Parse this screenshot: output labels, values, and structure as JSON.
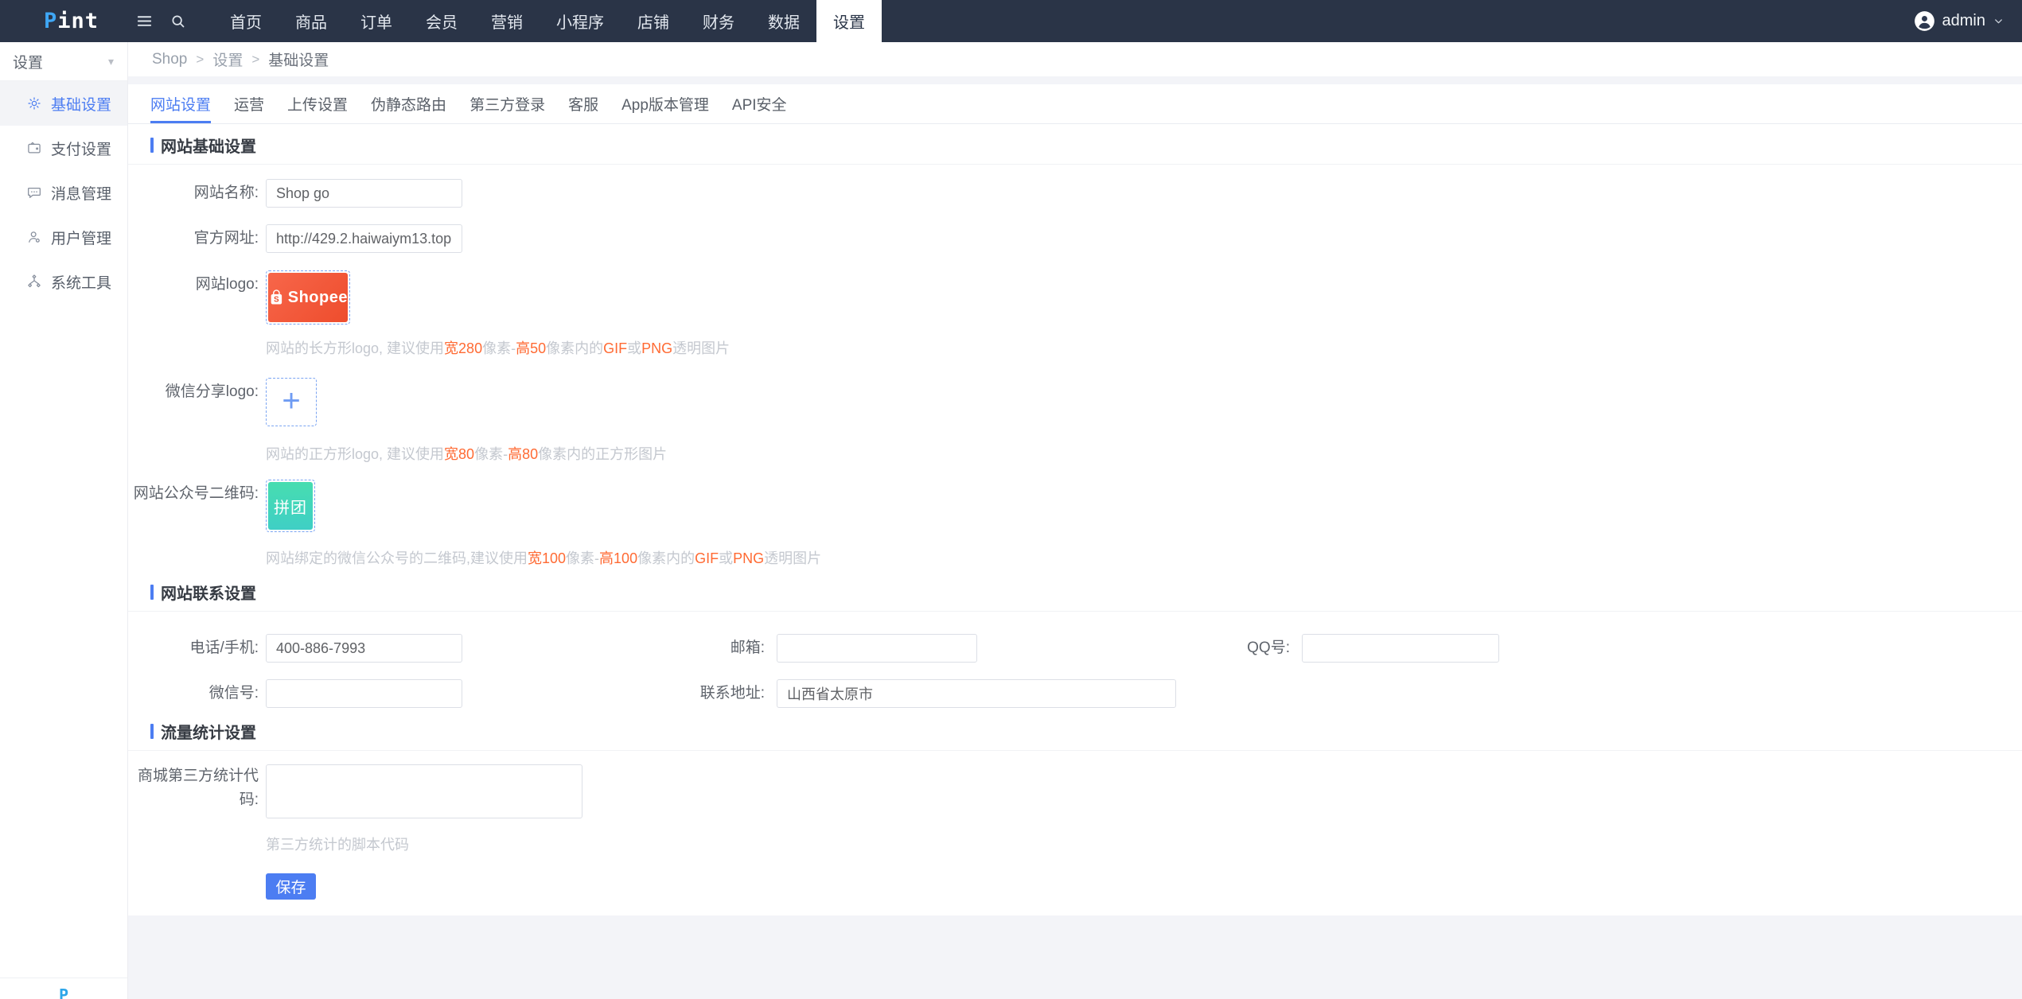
{
  "theme": {
    "navbar-bg": "#2a3447",
    "accent": "#4c7df2",
    "highlight": "#ff6a33",
    "shopee-a": "#f7664a",
    "shopee-b": "#ee4d2d",
    "qr-a": "#47ddb0",
    "qr-b": "#3fcfc5",
    "logo-blue": "#3fa7f5"
  },
  "navbar": {
    "logo_first": "P",
    "logo_rest": "int",
    "items": [
      {
        "label": "首页"
      },
      {
        "label": "商品"
      },
      {
        "label": "订单"
      },
      {
        "label": "会员"
      },
      {
        "label": "营销"
      },
      {
        "label": "小程序"
      },
      {
        "label": "店铺"
      },
      {
        "label": "财务"
      },
      {
        "label": "数据"
      },
      {
        "label": "设置"
      }
    ],
    "active_item": "设置",
    "user": {
      "name": "admin"
    }
  },
  "sidebar": {
    "title": "设置",
    "items": [
      {
        "label": "基础设置"
      },
      {
        "label": "支付设置"
      },
      {
        "label": "消息管理"
      },
      {
        "label": "用户管理"
      },
      {
        "label": "系统工具"
      }
    ],
    "active_item": "基础设置",
    "footer_logo": "P"
  },
  "breadcrumb": {
    "parts": [
      "Shop",
      "设置",
      "基础设置"
    ],
    "separator": ">"
  },
  "tabs": [
    {
      "label": "网站设置"
    },
    {
      "label": "运营"
    },
    {
      "label": "上传设置"
    },
    {
      "label": "伪静态路由"
    },
    {
      "label": "第三方登录"
    },
    {
      "label": "客服"
    },
    {
      "label": "App版本管理"
    },
    {
      "label": "API安全"
    }
  ],
  "active_tab": "网站设置",
  "form": {
    "basic": {
      "title": "网站基础设置",
      "site_name": {
        "label": "网站名称:",
        "value": "Shop go"
      },
      "site_url": {
        "label": "官方网址:",
        "value": "http://429.2.haiwaiym13.top"
      },
      "site_logo": {
        "label": "网站logo:",
        "image_text": "Shopee",
        "help": [
          {
            "t": "网站的长方形logo, 建议使用"
          },
          {
            "t": "宽280"
          },
          {
            "t": "像素-"
          },
          {
            "t": "高50"
          },
          {
            "t": "像素内的"
          },
          {
            "t": "GIF"
          },
          {
            "t": "或"
          },
          {
            "t": "PNG"
          },
          {
            "t": "透明图片"
          }
        ]
      },
      "share_logo": {
        "label": "微信分享logo:",
        "help": [
          {
            "t": "网站的正方形logo, 建议使用"
          },
          {
            "t": "宽80"
          },
          {
            "t": "像素-"
          },
          {
            "t": "高80"
          },
          {
            "t": "像素内的正方形图片"
          }
        ]
      },
      "qrcode": {
        "label": "网站公众号二维码:",
        "image_text": "拼团",
        "help": [
          {
            "t": "网站绑定的微信公众号的二维码,建议使用"
          },
          {
            "t": "宽100"
          },
          {
            "t": "像素-"
          },
          {
            "t": "高100"
          },
          {
            "t": "像素内的"
          },
          {
            "t": "GIF"
          },
          {
            "t": "或"
          },
          {
            "t": "PNG"
          },
          {
            "t": "透明图片"
          }
        ]
      }
    },
    "contact": {
      "title": "网站联系设置",
      "phone": {
        "label": "电话/手机:",
        "value": "400-886-7993"
      },
      "email": {
        "label": "邮箱:",
        "value": ""
      },
      "qq": {
        "label": "QQ号:",
        "value": ""
      },
      "wechat": {
        "label": "微信号:",
        "value": ""
      },
      "address": {
        "label": "联系地址:",
        "value": "山西省太原市"
      }
    },
    "stats": {
      "title": "流量统计设置",
      "code": {
        "label": "商城第三方统计代码:",
        "value": "",
        "help": "第三方统计的脚本代码"
      },
      "save_label": "保存"
    }
  }
}
